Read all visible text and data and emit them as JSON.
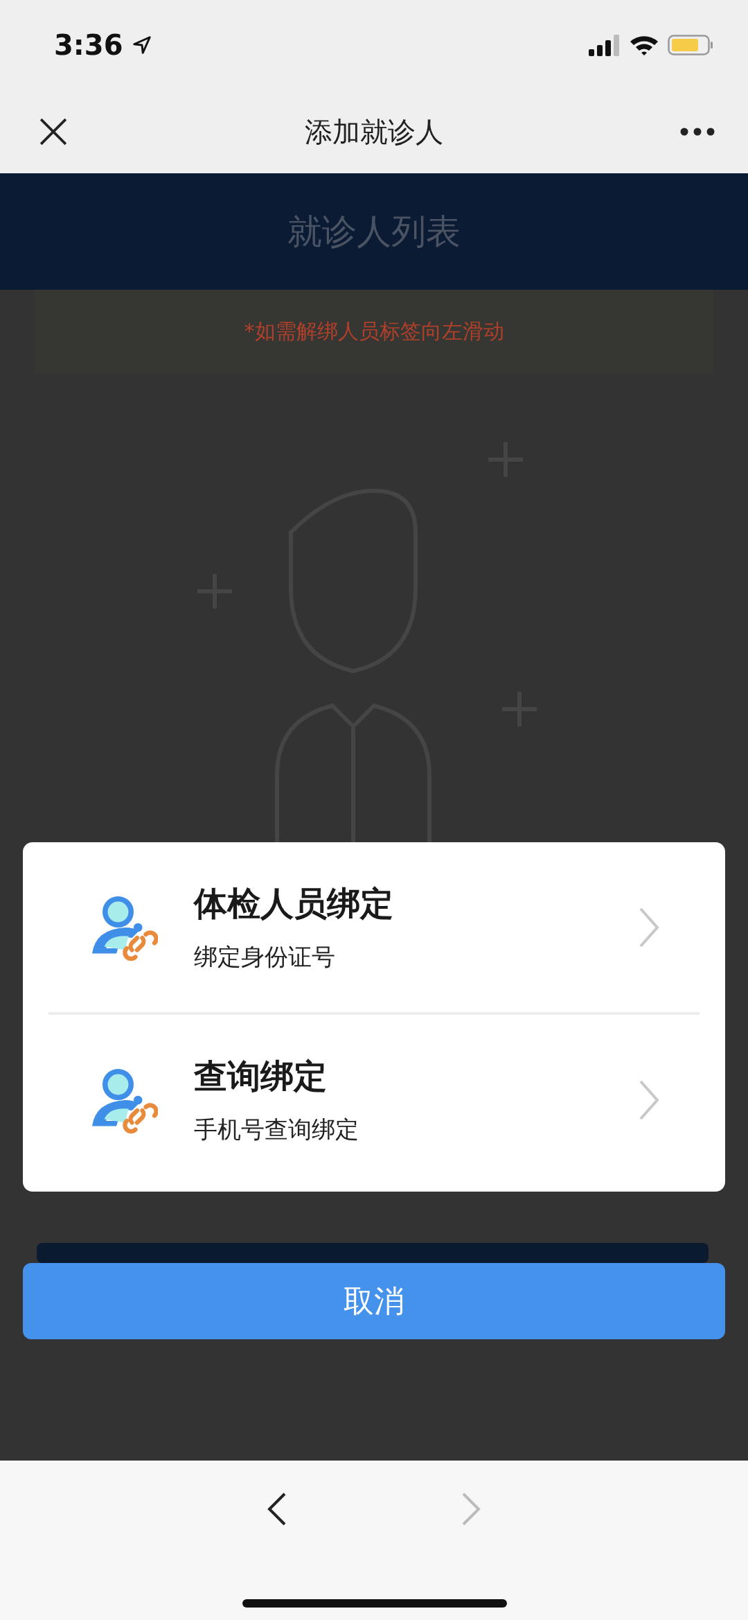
{
  "status_bar": {
    "time": "3:36"
  },
  "nav_bar": {
    "title": "添加就诊人"
  },
  "page": {
    "banner_title": "就诊人列表",
    "notice": "*如需解绑人员标签向左滑动"
  },
  "action_sheet": {
    "options": [
      {
        "title": "体检人员绑定",
        "subtitle": "绑定身份证号"
      },
      {
        "title": "查询绑定",
        "subtitle": "手机号查询绑定"
      }
    ],
    "cancel": "取消"
  },
  "toolbar": {
    "back_disabled": false,
    "forward_disabled": true
  }
}
